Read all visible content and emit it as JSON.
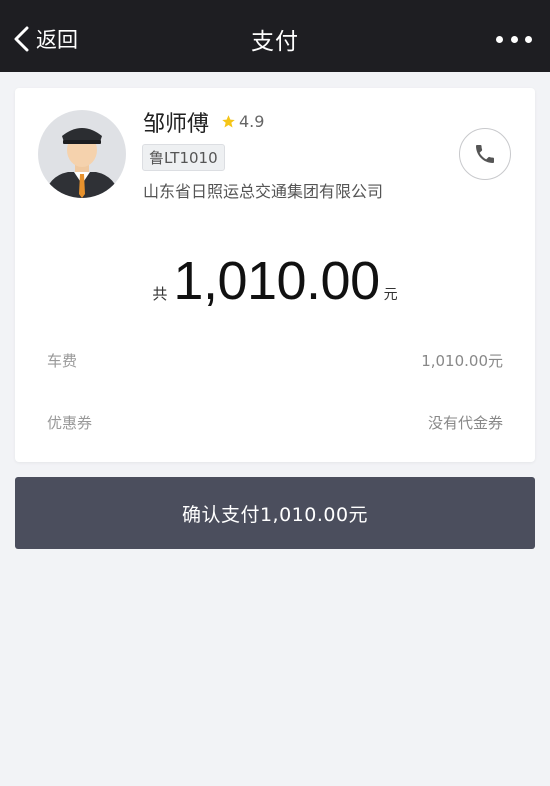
{
  "nav": {
    "back_label": "返回",
    "title": "支付",
    "more_icon": "more-dots-icon"
  },
  "driver": {
    "name": "邹师傅",
    "rating": "4.9",
    "plate": "鲁LT1010",
    "company": "山东省日照运总交通集团有限公司"
  },
  "payment": {
    "total_prefix": "共",
    "total_amount": "1,010.00",
    "total_unit": "元",
    "fee_label": "车费",
    "fee_value": "1,010.00元",
    "coupon_label": "优惠券",
    "coupon_value": "没有代金券"
  },
  "confirm_button": {
    "label": "确认支付1,010.00元"
  },
  "colors": {
    "navbar": "#1e1e22",
    "page_bg": "#f2f3f6",
    "button": "#4b4e5d",
    "star": "#f5c518"
  }
}
